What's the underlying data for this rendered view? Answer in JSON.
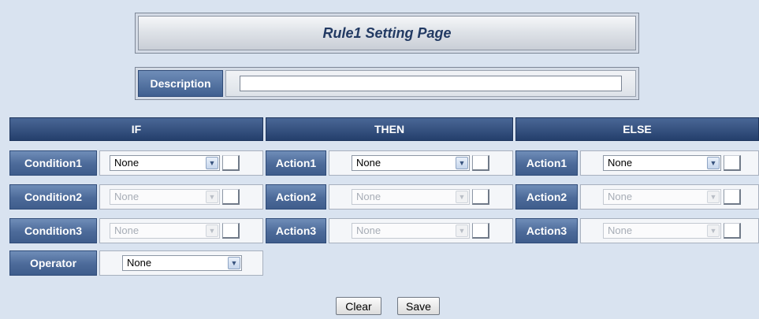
{
  "page": {
    "title": "Rule1 Setting Page",
    "description_label": "Description",
    "description_value": ""
  },
  "sections": {
    "if": "IF",
    "then": "THEN",
    "else": "ELSE"
  },
  "if_rows": [
    {
      "label": "Condition1",
      "value": "None",
      "enabled": true
    },
    {
      "label": "Condition2",
      "value": "None",
      "enabled": false
    },
    {
      "label": "Condition3",
      "value": "None",
      "enabled": false
    }
  ],
  "operator": {
    "label": "Operator",
    "value": "None"
  },
  "then_rows": [
    {
      "label": "Action1",
      "value": "None",
      "enabled": true
    },
    {
      "label": "Action2",
      "value": "None",
      "enabled": false
    },
    {
      "label": "Action3",
      "value": "None",
      "enabled": false
    }
  ],
  "else_rows": [
    {
      "label": "Action1",
      "value": "None",
      "enabled": true
    },
    {
      "label": "Action2",
      "value": "None",
      "enabled": false
    },
    {
      "label": "Action3",
      "value": "None",
      "enabled": false
    }
  ],
  "buttons": {
    "clear": "Clear",
    "save": "Save"
  },
  "icons": {
    "select_arrow": "chevron-down-icon"
  },
  "colors": {
    "header_bg": "#243f6c",
    "label_bg": "#4c6a99",
    "page_bg": "#d9e3f0"
  }
}
